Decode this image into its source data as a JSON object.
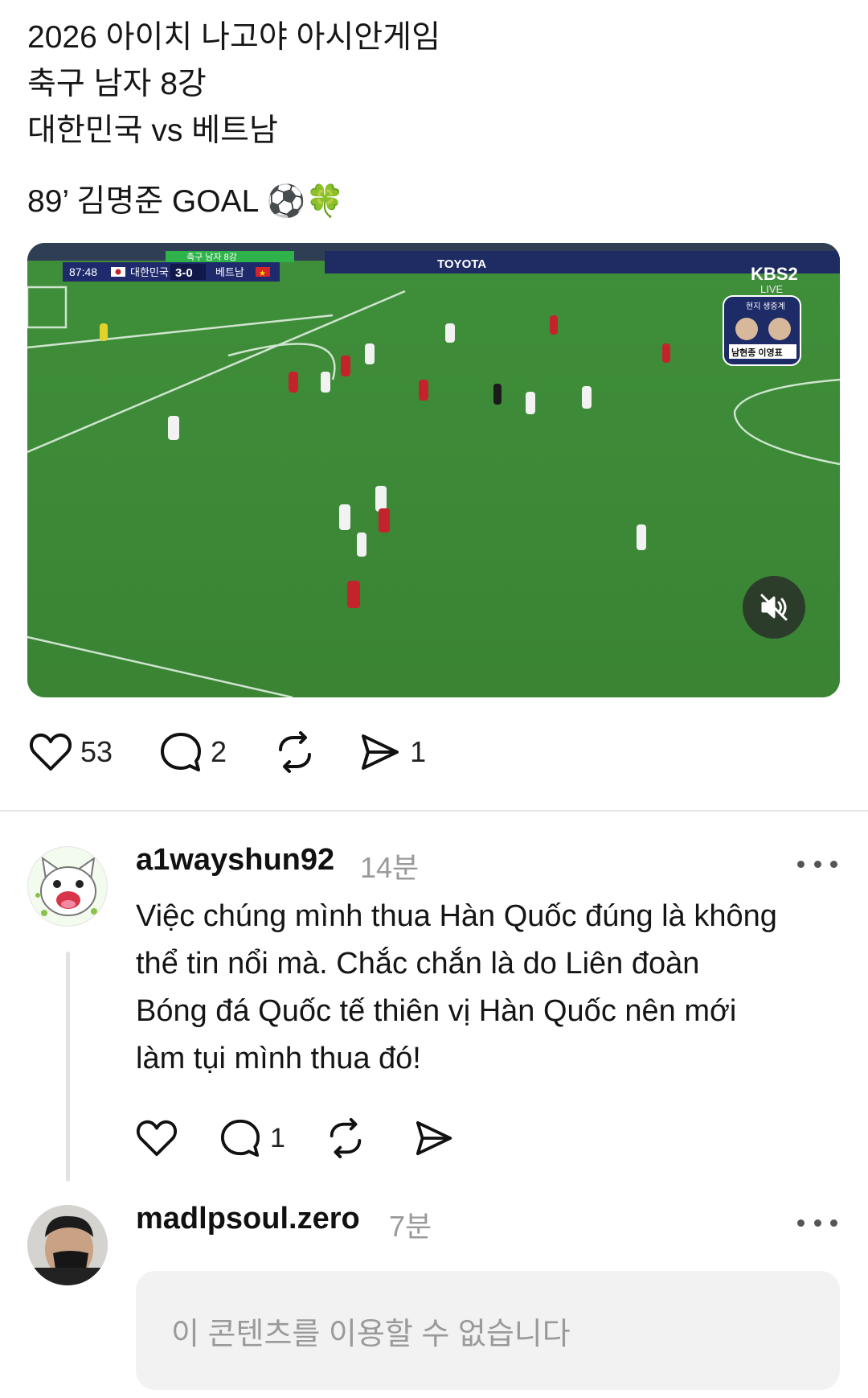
{
  "post": {
    "lines": [
      "2026 아이치 나고야 아시안게임",
      "축구 남자 8강",
      "대한민국 vs 베트남"
    ],
    "goal_line": "89’ 김명준 GOAL ⚽🍀"
  },
  "video": {
    "overlay": {
      "competition": "축구 남자 8강",
      "clock": "87:48",
      "home_team": "대한민국",
      "score": "3-0",
      "away_team": "베트남",
      "broadcaster": "KBS2",
      "broadcaster_sub": "LIVE",
      "commentary_header": "현지 생중계",
      "commentators": "남현종 이영표",
      "board_ad": "TOYOTA"
    },
    "mute_icon": "speaker-muted-icon"
  },
  "post_actions": {
    "likes": "53",
    "comments": "2",
    "reposts": "",
    "shares": "1"
  },
  "comments": [
    {
      "username": "a1wayshun92",
      "time": "14분",
      "lines": [
        "Việc chúng mình thua Hàn Quốc đúng là không",
        "thể tin nổi mà. Chắc chắn là do Liên đoàn",
        "Bóng đá Quốc tế thiên vị Hàn Quốc nên mới",
        "làm tụi mình thua đó!"
      ],
      "replies": "1"
    },
    {
      "username": "madlpsoul.zero",
      "time": "7분",
      "unavailable_text": "이 콘텐츠를 이용할 수 없습니다"
    }
  ]
}
